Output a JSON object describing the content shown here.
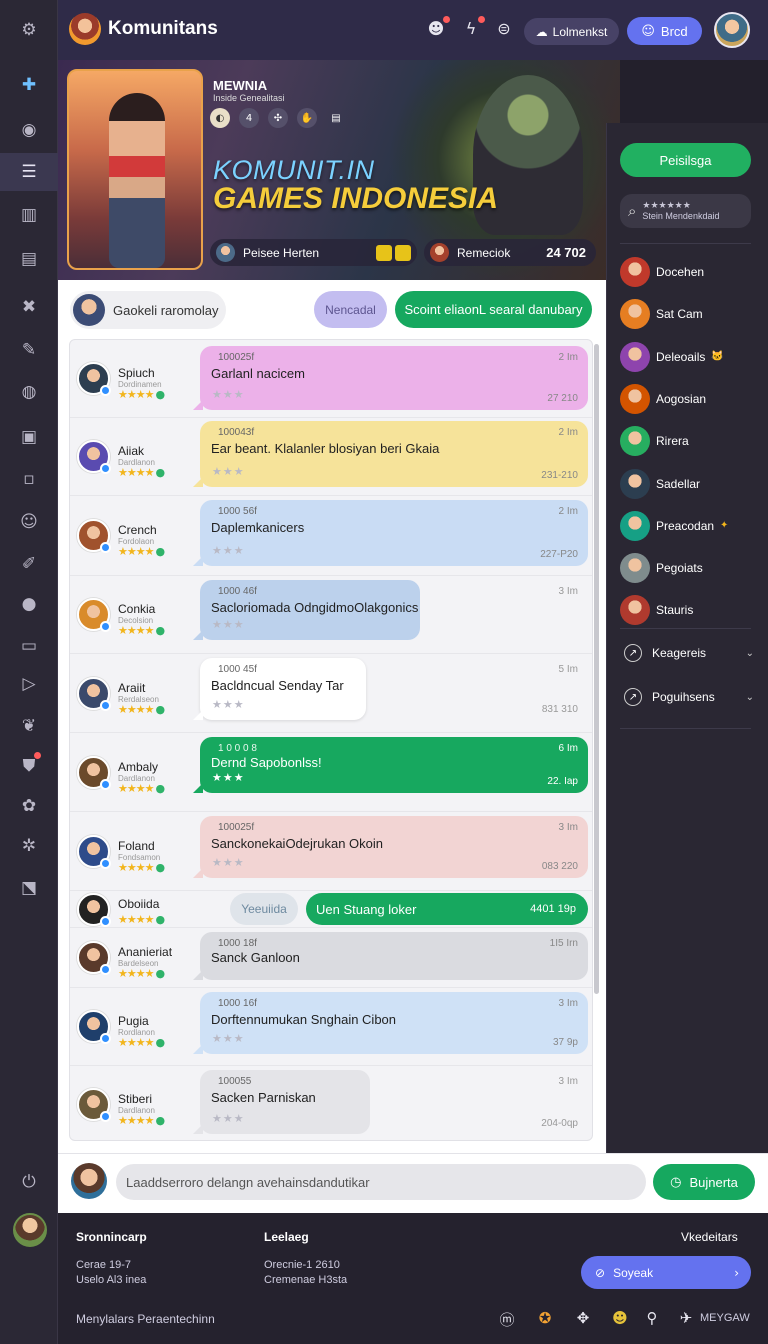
{
  "app": {
    "title": "Komunitans"
  },
  "topbar": {
    "icons": [
      "robot-icon",
      "lightning-icon",
      "coins-icon"
    ],
    "komunitas_label": "Lolmenkst",
    "brod_label": "Brcd"
  },
  "hero": {
    "subtitle": "MEWNIA",
    "subtitle2": "Inside Genealitasi",
    "title_line1": "KOMUNIT.IN",
    "title_line2": "GAMES INDONESIA",
    "player_label": "Peisee Herten",
    "remeook_label": "Remeciok",
    "count": "24 702"
  },
  "right_panel": {
    "primary_button": "Peisilsga",
    "search_stars": "★★★★★★",
    "search_text": "Stein Mendenkdaid",
    "members": [
      {
        "name": "Docehen",
        "color": "#c0392b"
      },
      {
        "name": "Sat Cam",
        "color": "#e67e22"
      },
      {
        "name": "Deleoails",
        "badge": "🐱",
        "color": "#8e44ad"
      },
      {
        "name": "Aogosian",
        "color": "#d35400"
      },
      {
        "name": "Rirera",
        "color": "#27ae60"
      },
      {
        "name": "Sadellar",
        "color": "#2c3e50"
      },
      {
        "name": "Preacodan",
        "badge": "✦",
        "color": "#16a085"
      },
      {
        "name": "Pegoiats",
        "color": "#7f8c8d"
      },
      {
        "name": "Stauris",
        "color": "#b03a2e"
      }
    ],
    "categories": [
      {
        "name": "Keagereis"
      },
      {
        "name": "Poguihsens"
      }
    ]
  },
  "main": {
    "user_chip": "Gaokeli raromolay",
    "nencadal_label": "Nencadal",
    "scoint_label": "Scoint eliaonL searal danubary",
    "messages": [
      {
        "name": "Spiuch",
        "sub": "Dordinamen",
        "code": "100025f",
        "text": "Garlanl nacicem",
        "time": "2 Im",
        "foot": "27 210",
        "bg": "#ecb1e9",
        "avc": "#2d3e50"
      },
      {
        "name": "Aiiak",
        "sub": "Dardlanon",
        "code": "100043f",
        "text": "Ear beant. Klalanler blosiyan beri Gkaia",
        "time": "2 Im",
        "foot": "231-210",
        "bg": "#f6e39a",
        "avc": "#5a4bb0"
      },
      {
        "name": "Crench",
        "sub": "Fordolaon",
        "code": "1000 56f",
        "text": "Daplemkanicers",
        "time": "2 Im",
        "foot": "227-P20",
        "bg": "#c9dcf4",
        "avc": "#a0522d"
      },
      {
        "name": "Conkia",
        "sub": "Decolsion",
        "code": "1000 46f",
        "text": "Sacloriomada OdngidmoOlakgonics",
        "time": "3 Im",
        "foot": "",
        "bg": "#bcd1ec",
        "avc": "#d98b2b"
      },
      {
        "name": "Araiit",
        "sub": "Rerdalseon",
        "code": "1000 45f",
        "text": "Bacldncual Senday Tar",
        "time": "5 Im",
        "foot": "831 310",
        "bg": "#ffffff",
        "avc": "#3b4a6b"
      },
      {
        "name": "Ambaly",
        "sub": "Dardlanon",
        "code": "1 0 0 0 8",
        "text": "Dernd Sapobonlss!",
        "time": "6 Im",
        "foot": "22. Iap",
        "bg": "#17a85f",
        "avc": "#6b4a2b"
      },
      {
        "name": "Foland",
        "sub": "Fondsamon",
        "code": "100025f",
        "text": "SanckonekaiOdejrukan Okoin",
        "time": "3 Im",
        "foot": "083 220",
        "bg": "#f2d4d3",
        "avc": "#2e4b8a"
      },
      {
        "name": "Oboiida",
        "sub": "",
        "code": "",
        "text": "Uen Stuang loker",
        "time": "",
        "foot": "4401 19p",
        "bg": "#17a85f",
        "avc": "#222"
      },
      {
        "name": "Ananieriat",
        "sub": "Bardelseon",
        "code": "1000 18f",
        "text": "Sanck Ganloon",
        "time": "1I5 Irn",
        "foot": "",
        "bg": "#dadbe0",
        "avc": "#5a3a2b"
      },
      {
        "name": "Pugia",
        "sub": "Rordlanon",
        "code": "1000 16f",
        "text": "Dorftennumukan Snghain Cibon",
        "time": "3 Im",
        "foot": "37 9p",
        "bg": "#cfe1f6",
        "avc": "#1f3f6b"
      },
      {
        "name": "Stiberi",
        "sub": "Dardlanon",
        "code": "100055",
        "text": "Sacken Parniskan",
        "time": "3 Im",
        "foot": "204-0qp",
        "bg": "#e4e4e8",
        "avc": "#6b5a3a"
      }
    ],
    "outer_pill": "Yeeuiida"
  },
  "composer": {
    "placeholder": "Laaddserroro delangn avehainsdandutikar",
    "send_label": "Bujnerta"
  },
  "footer": {
    "col1_title": "Sronnincarp",
    "col1_line1": "Cerae 19-7",
    "col1_line2": "Uselo Al3 inea",
    "col2_title": "Leelaeg",
    "col2_line1": "Orecnie-1 2610",
    "col2_line2": "Cremenae H3sta",
    "col3_title": "Vkedeitars",
    "button_label": "Soyeak",
    "bottom_text": "Menylalars Peraentechinn",
    "brand": "MEYGAW"
  }
}
